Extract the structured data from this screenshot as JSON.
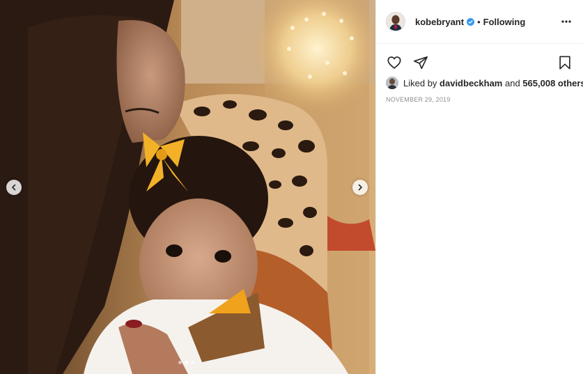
{
  "post": {
    "author": {
      "username": "kobebryant",
      "verified": true,
      "follow_state": "Following",
      "separator": "•"
    },
    "likes": {
      "prefix": "Liked by",
      "liked_by_user": "davidbeckham",
      "conjunction": "and",
      "others_text": "565,008 others"
    },
    "date": "NOVEMBER 29, 2019",
    "carousel": {
      "total_slides": 3,
      "current_slide": 2
    },
    "icons": {
      "more": "more-options-icon",
      "like": "heart-icon",
      "share": "paper-plane-icon",
      "save": "bookmark-icon",
      "prev": "chevron-left-icon",
      "next": "chevron-right-icon",
      "verified": "verified-badge-icon"
    },
    "colors": {
      "verified_blue": "#3897f0",
      "text": "#262626",
      "muted": "#8e8e8e",
      "divider": "#efefef"
    }
  }
}
